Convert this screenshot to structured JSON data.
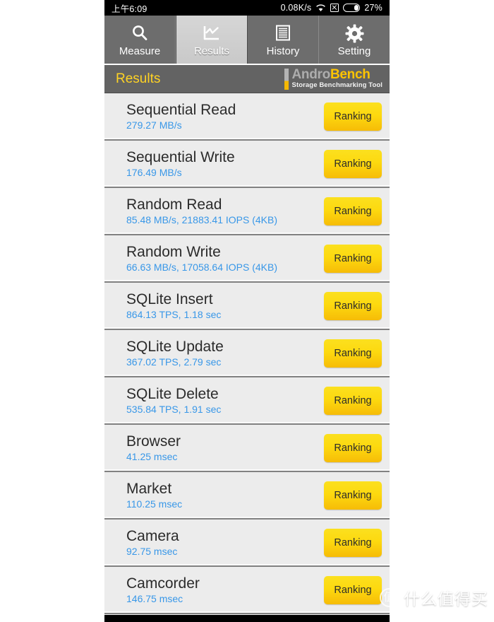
{
  "statusbar": {
    "time": "上午6:09",
    "network_speed": "0.08K/s",
    "wifi_icon": "wifi-icon",
    "sim_icon": "sim-disabled-icon",
    "battery_icon": "battery-icon",
    "battery_percent": "27%"
  },
  "tabs": [
    {
      "label": "Measure",
      "icon": "magnifier-icon",
      "selected": false
    },
    {
      "label": "Results",
      "icon": "chart-icon",
      "selected": true
    },
    {
      "label": "History",
      "icon": "list-lines-icon",
      "selected": false
    },
    {
      "label": "Setting",
      "icon": "gear-icon",
      "selected": false
    }
  ],
  "header": {
    "title": "Results",
    "logo_andro": "Andro",
    "logo_bench": "Bench",
    "logo_tagline": "Storage Benchmarking Tool"
  },
  "ranking_label": "Ranking",
  "results": [
    {
      "title": "Sequential Read",
      "value": "279.27 MB/s"
    },
    {
      "title": "Sequential Write",
      "value": "176.49 MB/s"
    },
    {
      "title": "Random Read",
      "value": "85.48 MB/s, 21883.41 IOPS (4KB)"
    },
    {
      "title": "Random Write",
      "value": "66.63 MB/s, 17058.64 IOPS (4KB)"
    },
    {
      "title": "SQLite Insert",
      "value": "864.13 TPS, 1.18 sec"
    },
    {
      "title": "SQLite Update",
      "value": "367.02 TPS, 2.79 sec"
    },
    {
      "title": "SQLite Delete",
      "value": "535.84 TPS, 1.91 sec"
    },
    {
      "title": "Browser",
      "value": "41.25 msec"
    },
    {
      "title": "Market",
      "value": "110.25 msec"
    },
    {
      "title": "Camera",
      "value": "92.75 msec"
    },
    {
      "title": "Camcorder",
      "value": "146.75 msec"
    }
  ],
  "watermark": {
    "badge": "值",
    "text": "什么值得买"
  },
  "colors": {
    "accent_yellow": "#ffd324",
    "value_blue": "#3897e8",
    "tabbar_gray": "#6d6d6d",
    "header_gray": "#636363",
    "list_bg": "#ececec"
  }
}
